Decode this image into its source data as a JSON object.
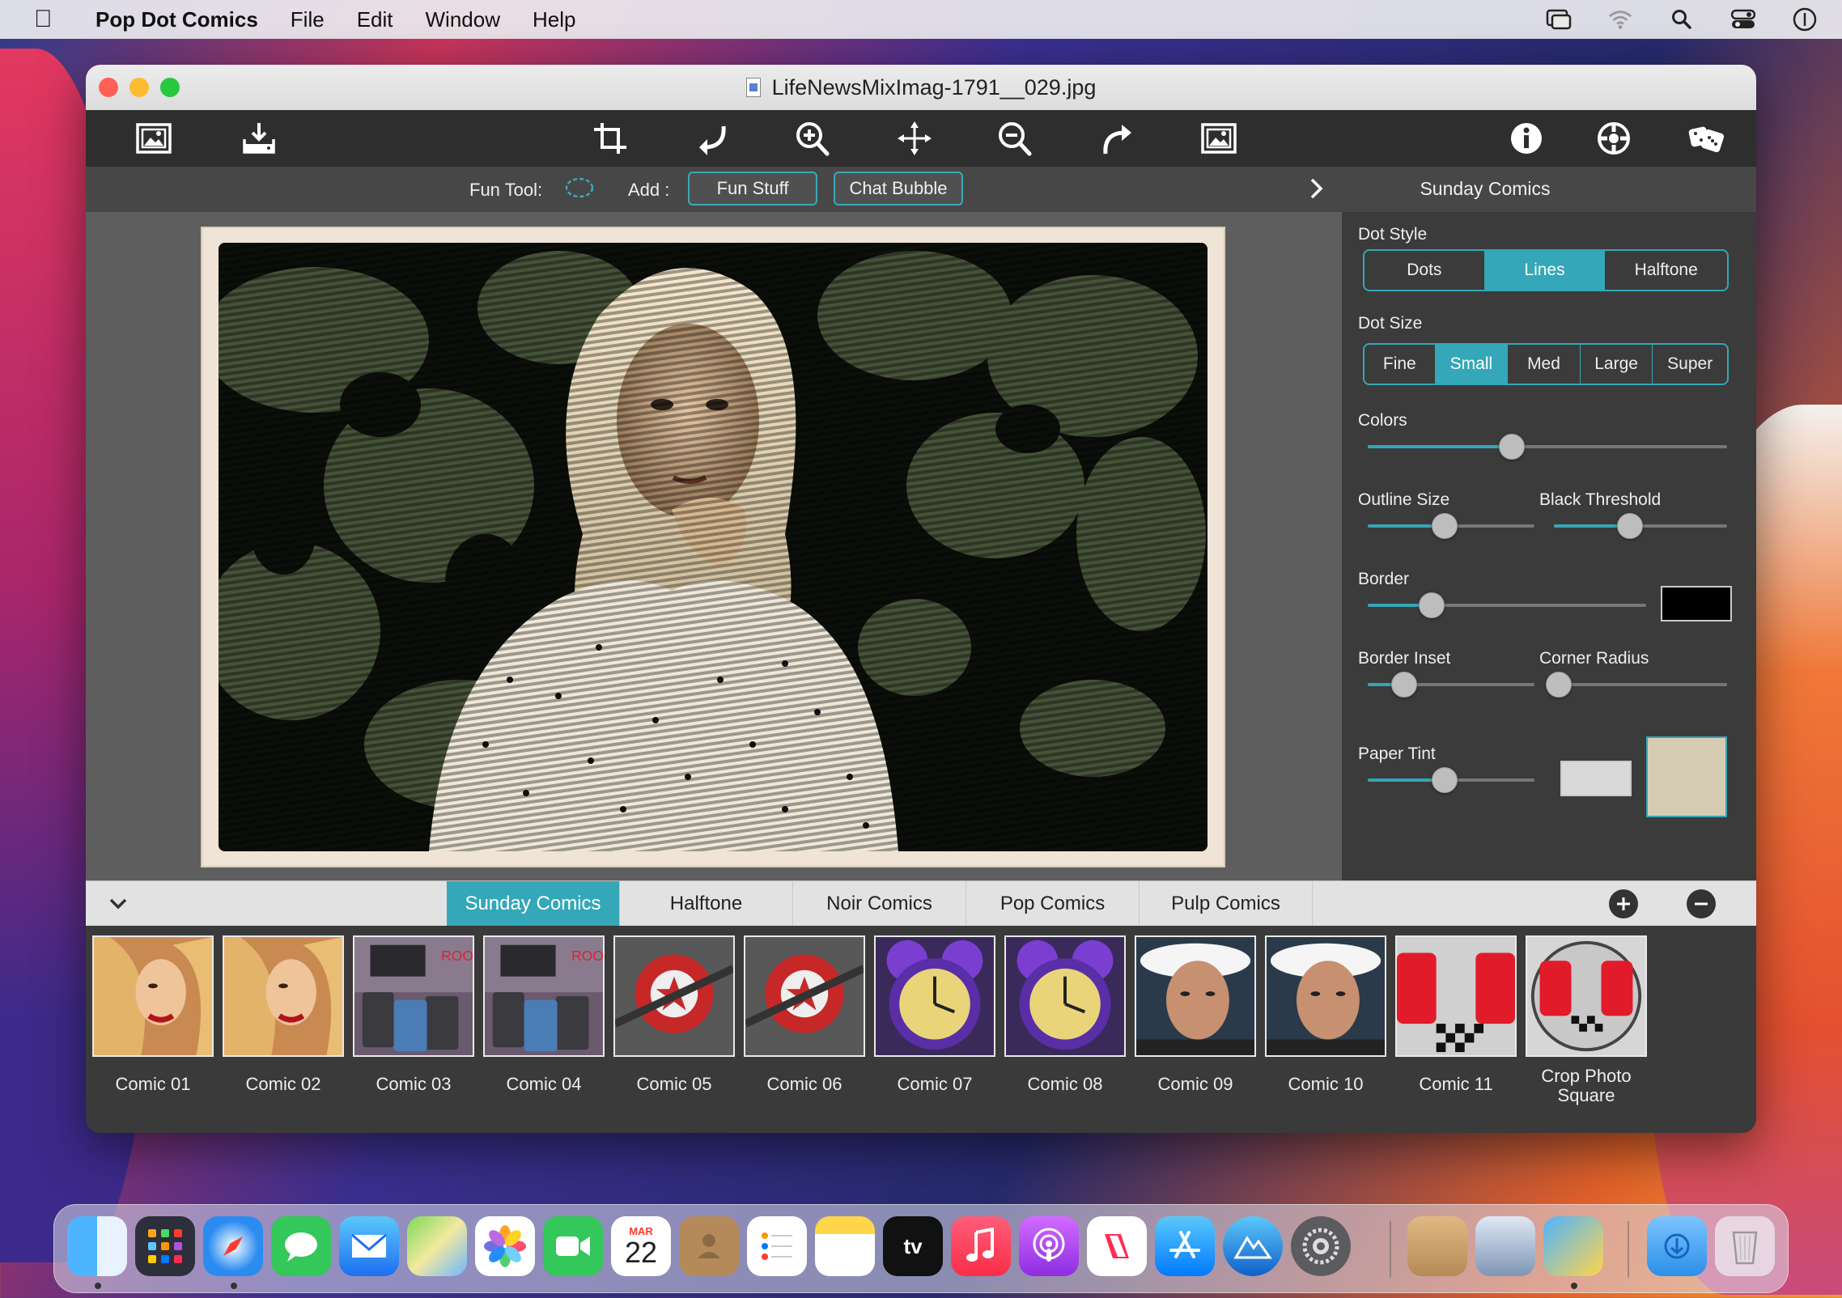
{
  "menubar": {
    "app_name": "Pop Dot Comics",
    "items": [
      "File",
      "Edit",
      "Window",
      "Help"
    ]
  },
  "window": {
    "title": "LifeNewsMixImag-1791__029.jpg"
  },
  "funbar": {
    "fun_tool_label": "Fun Tool:",
    "add_label": "Add :",
    "fun_stuff": "Fun Stuff",
    "chat_bubble": "Chat Bubble"
  },
  "panel": {
    "title": "Sunday Comics",
    "dot_style_label": "Dot Style",
    "dot_style_options": [
      "Dots",
      "Lines",
      "Halftone"
    ],
    "dot_style_selected": "Lines",
    "dot_size_label": "Dot Size",
    "dot_size_options": [
      "Fine",
      "Small",
      "Med",
      "Large",
      "Super"
    ],
    "dot_size_selected": "Small",
    "colors_label": "Colors",
    "colors_value": 0.4,
    "outline_size_label": "Outline Size",
    "outline_size_value": 0.46,
    "black_threshold_label": "Black Threshold",
    "black_threshold_value": 0.44,
    "border_label": "Border",
    "border_value": 0.23,
    "border_color": "#000000",
    "border_inset_label": "Border Inset",
    "border_inset_value": 0.22,
    "corner_radius_label": "Corner Radius",
    "corner_radius_value": 0.03,
    "paper_tint_label": "Paper Tint",
    "paper_tint_value": 0.46,
    "paper_tint_color": "#d9d9d9",
    "paper_texture_color": "#d6ccb4"
  },
  "tabs": {
    "items": [
      "Sunday Comics",
      "Halftone",
      "Noir Comics",
      "Pop Comics",
      "Pulp Comics"
    ],
    "active": "Sunday Comics"
  },
  "presets": [
    {
      "label": "Comic 01",
      "scene": "woman"
    },
    {
      "label": "Comic 02",
      "scene": "woman"
    },
    {
      "label": "Comic 03",
      "scene": "bins"
    },
    {
      "label": "Comic 04",
      "scene": "bins"
    },
    {
      "label": "Comic 05",
      "scene": "plane"
    },
    {
      "label": "Comic 06",
      "scene": "plane"
    },
    {
      "label": "Comic 07",
      "scene": "clock"
    },
    {
      "label": "Comic 08",
      "scene": "clock"
    },
    {
      "label": "Comic 09",
      "scene": "man"
    },
    {
      "label": "Comic 10",
      "scene": "man"
    },
    {
      "label": "Comic 11",
      "scene": "diner"
    },
    {
      "label": "Crop Photo Square",
      "scene": "diner-round"
    }
  ],
  "colors": {
    "accent": "#34a8b8",
    "toolbar_bg": "#2e2e2e",
    "panel_bg": "#3b3b3b"
  },
  "dock": {
    "calendar_month": "MAR",
    "calendar_day": "22",
    "tv_label": "tv"
  }
}
